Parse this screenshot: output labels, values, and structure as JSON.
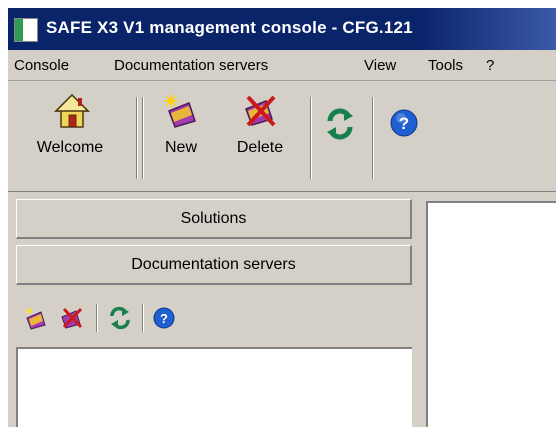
{
  "window": {
    "title": "SAFE X3 V1 management console - CFG.121",
    "icon": "app-icon"
  },
  "menubar": {
    "items": [
      "Console",
      "Documentation servers",
      "View",
      "Tools",
      "?"
    ]
  },
  "toolbar": {
    "welcome_label": "Welcome",
    "new_label": "New",
    "delete_label": "Delete",
    "icons": [
      "home-icon",
      "new-book-icon",
      "delete-book-icon",
      "refresh-icon",
      "help-icon"
    ]
  },
  "left_panel": {
    "solutions_label": "Solutions",
    "doc_servers_label": "Documentation servers",
    "small_toolbar_icons": [
      "new-book-icon",
      "delete-book-icon",
      "refresh-icon",
      "help-icon"
    ]
  },
  "colors": {
    "titlebar": "#0a246a",
    "face": "#d4d0c8",
    "help_blue": "#1f5fd0",
    "refresh_green": "#1a7f4e",
    "delete_red": "#cc1a1a"
  }
}
